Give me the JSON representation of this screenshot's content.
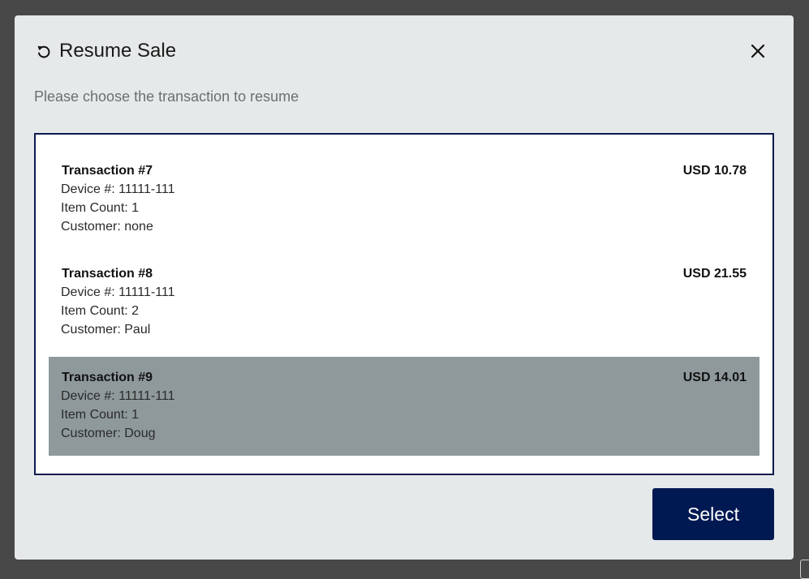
{
  "dialog": {
    "title": "Resume Sale",
    "subtitle": "Please choose the transaction to resume",
    "title_icon": "undo-icon",
    "close_icon": "close-icon",
    "select_label": "Select"
  },
  "transactions": [
    {
      "title": "Transaction #7",
      "amount": "USD 10.78",
      "device": "Device #: 11111-111",
      "item_count": "Item Count: 1",
      "customer": "Customer: none",
      "selected": false
    },
    {
      "title": "Transaction #8",
      "amount": "USD 21.55",
      "device": "Device #: 11111-111",
      "item_count": "Item Count: 2",
      "customer": "Customer: Paul",
      "selected": false
    },
    {
      "title": "Transaction #9",
      "amount": "USD 14.01",
      "device": "Device #: 11111-111",
      "item_count": "Item Count: 1",
      "customer": "Customer: Doug",
      "selected": true
    }
  ],
  "colors": {
    "accent": "#001952",
    "selected_row": "#8f999b",
    "dialog_bg": "#e6e9ea",
    "list_border": "#0d1b4d"
  }
}
